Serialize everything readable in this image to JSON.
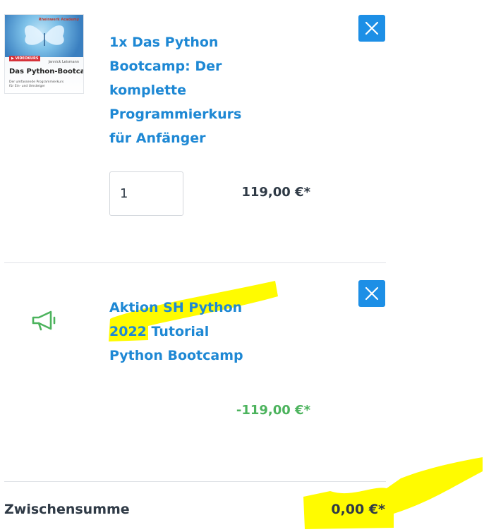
{
  "product": {
    "title_lines": [
      "1x Das Python",
      "Bootcamp: Der",
      "komplette",
      "Programmierkurs",
      "für Anfänger"
    ],
    "quantity": "1",
    "price": "119,00 €*",
    "thumbnail": {
      "publisher": "Rheinwerk Academy",
      "badge": "▶ VIDEOKURS",
      "author": "Jannick Leismann",
      "title": "Das Python-Bootcamp",
      "subtitle": "Der umfassende Programmierkurs für Ein- und Umsteiger"
    }
  },
  "promotion": {
    "title_line1": "Aktion SH Python",
    "title_line2_highlight": "2022",
    "title_line2_rest": " Tutorial",
    "title_line3": "Python Bootcamp",
    "price": "-119,00 €*",
    "icon": "megaphone-icon"
  },
  "summary": {
    "label": "Zwischensumme",
    "value": "0,00 €*"
  },
  "colors": {
    "link": "#1e88d4",
    "button": "#1d8fe6",
    "discount": "#4cb35d",
    "highlight": "#fffb00"
  }
}
